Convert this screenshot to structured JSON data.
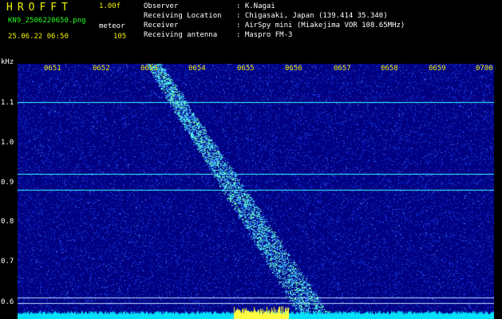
{
  "header": {
    "app_title": "HROFFT",
    "version": "1.00f",
    "filename": "KN9_2506220650.png",
    "mode": "meteor",
    "datetime": "25.06.22 06:50",
    "count": "105"
  },
  "info": [
    {
      "label": "Observer",
      "value": ": K.Nagai"
    },
    {
      "label": "Receiving Location",
      "value": ": Chigasaki, Japan (139.414 35.340)"
    },
    {
      "label": "Receiver",
      "value": ": AirSpy mini (Miakejima VOR 108.65MHz)"
    },
    {
      "label": "Receiving antenna",
      "value": ": Maspro FM-3"
    }
  ],
  "plot": {
    "y_unit": "kHz",
    "x_ticks": [
      "0651",
      "0652",
      "0653",
      "0654",
      "0655",
      "0656",
      "0657",
      "0658",
      "0659",
      "0700"
    ],
    "y_ticks": [
      "1.1",
      "1.0",
      "0.9",
      "0.8",
      "0.7",
      "0.6"
    ],
    "colors": {
      "background": "#000080",
      "noise": "#2040ff",
      "signal": "#40ffff",
      "peak": "#ffff40"
    },
    "carrier_lines_khz": [
      1.105,
      0.925,
      0.885,
      0.615,
      0.6
    ]
  }
}
